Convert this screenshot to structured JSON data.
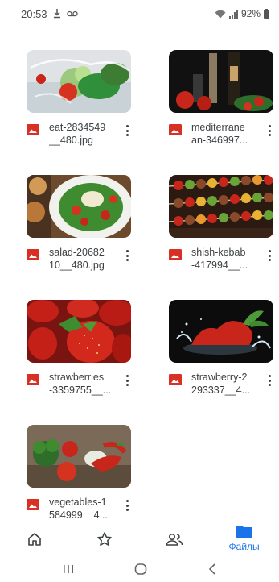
{
  "status_bar": {
    "time": "20:53",
    "battery": "92%"
  },
  "files": [
    {
      "name": "eat-2834549__480.jpg",
      "name_display": "eat-2834549\n__480.jpg",
      "thumb": "salad-splash"
    },
    {
      "name": "mediterranean-346997...",
      "name_display": "mediterrane\nan-346997...",
      "thumb": "mediterranean"
    },
    {
      "name": "salad-2068210__480.jpg",
      "name_display": "salad-20682\n10__480.jpg",
      "thumb": "salad-plate"
    },
    {
      "name": "shish-kebab-417994__...",
      "name_display": "shish-kebab\n-417994__...",
      "thumb": "kebab"
    },
    {
      "name": "strawberries-3359755__...",
      "name_display": "strawberries\n-3359755__...",
      "thumb": "strawberries"
    },
    {
      "name": "strawberry-2293337__4...",
      "name_display": "strawberry-2\n293337__4...",
      "thumb": "strawberry-splash"
    },
    {
      "name": "vegetables-1584999__4...",
      "name_display": "vegetables-1\n584999__4...",
      "thumb": "vegetables"
    }
  ],
  "bottom_nav": {
    "items": [
      {
        "icon": "home-icon",
        "label": ""
      },
      {
        "icon": "star-icon",
        "label": ""
      },
      {
        "icon": "shared-people-icon",
        "label": ""
      },
      {
        "icon": "folder-icon",
        "label": "Файлы"
      }
    ],
    "accent_color": "#1a73e8"
  },
  "colors": {
    "image_badge": "#d93025",
    "text": "#3c4043"
  }
}
